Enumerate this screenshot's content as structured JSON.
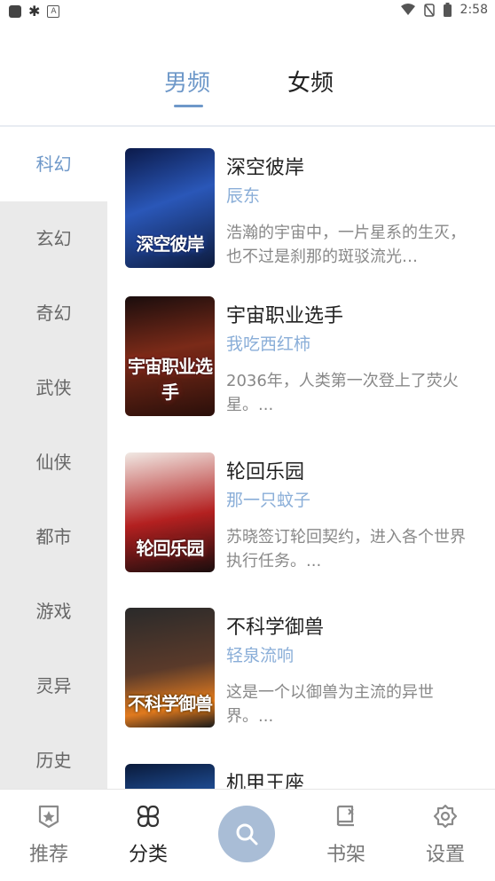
{
  "status_bar": {
    "time": "2:58",
    "icons": [
      "notification-square-icon",
      "bug-icon",
      "a-icon",
      "wifi-icon",
      "no-sim-icon",
      "battery-icon"
    ]
  },
  "tabs": [
    {
      "label": "男频",
      "active": true
    },
    {
      "label": "女频",
      "active": false
    }
  ],
  "categories": [
    {
      "label": "科幻",
      "active": true
    },
    {
      "label": "玄幻",
      "active": false
    },
    {
      "label": "奇幻",
      "active": false
    },
    {
      "label": "武侠",
      "active": false
    },
    {
      "label": "仙侠",
      "active": false
    },
    {
      "label": "都市",
      "active": false
    },
    {
      "label": "游戏",
      "active": false
    },
    {
      "label": "灵异",
      "active": false
    },
    {
      "label": "历史",
      "active": false
    }
  ],
  "books": [
    {
      "title": "深空彼岸",
      "author": "辰东",
      "description": "浩瀚的宇宙中，一片星系的生灭，也不过是刹那的斑驳流光…",
      "cover_text": "深空彼岸"
    },
    {
      "title": "宇宙职业选手",
      "author": "我吃西红柿",
      "description": "2036年，人类第一次登上了荧火星。...",
      "cover_text": "宇宙职业选手"
    },
    {
      "title": "轮回乐园",
      "author": "那一只蚊子",
      "description": "苏晓签订轮回契约，进入各个世界执行任务。...",
      "cover_text": "轮回乐园"
    },
    {
      "title": "不科学御兽",
      "author": "轻泉流响",
      "description": "这是一个以御兽为主流的异世界。...",
      "cover_text": "不科学御兽"
    },
    {
      "title": "机甲王座",
      "author": "",
      "description": "",
      "cover_text": ""
    }
  ],
  "bottom_nav": [
    {
      "label": "推荐",
      "icon": "badge-star-icon",
      "active": false
    },
    {
      "label": "分类",
      "icon": "category-grid-icon",
      "active": true
    },
    {
      "label": "",
      "icon": "search-icon",
      "active": false
    },
    {
      "label": "书架",
      "icon": "bookshelf-icon",
      "active": false
    },
    {
      "label": "设置",
      "icon": "gear-icon",
      "active": false
    }
  ],
  "colors": {
    "accent": "#6e98c9",
    "author": "#8aaed8",
    "sidebar_bg": "#eaeaea",
    "search_button": "#a9bdd6"
  }
}
